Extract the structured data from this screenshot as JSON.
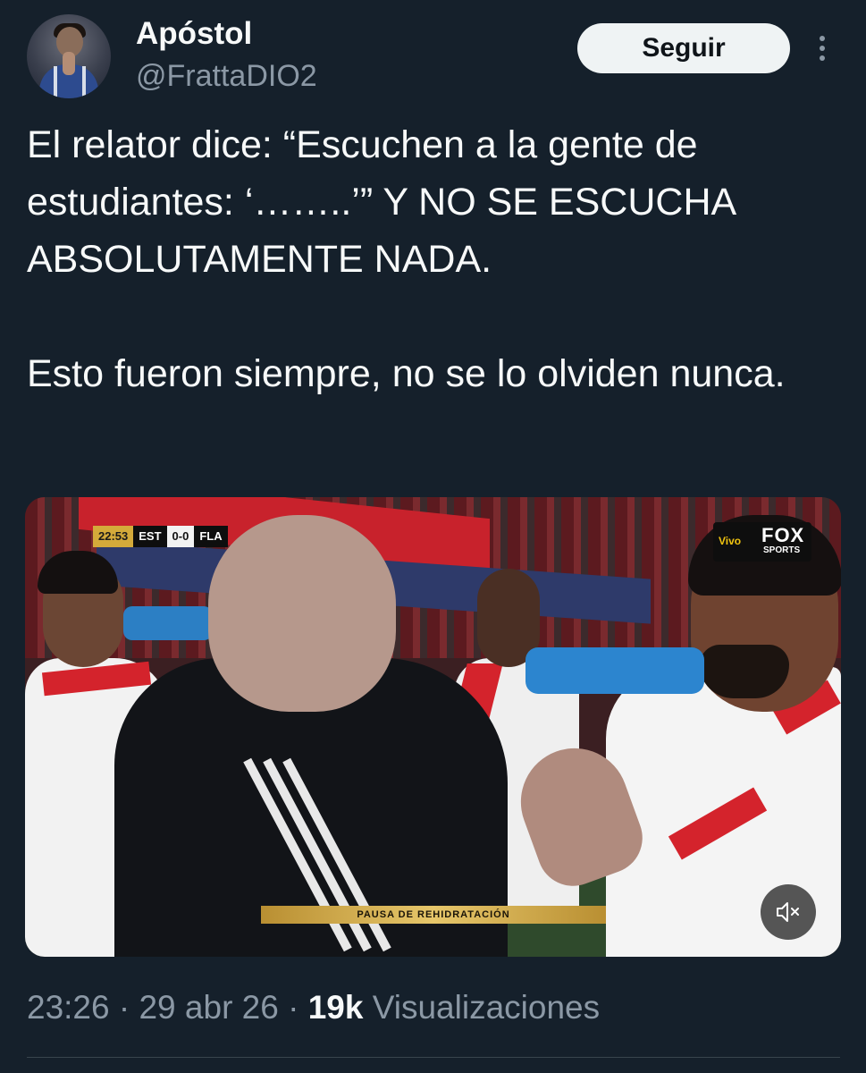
{
  "author": {
    "display_name": "Apóstol",
    "handle": "@FrattaDIO2"
  },
  "actions": {
    "follow_label": "Seguir",
    "more_icon": "more-vertical-icon"
  },
  "tweet": {
    "paragraphs": [
      "El relator dice: “Escuchen a la gente de estudiantes: ‘……..’” Y NO SE ESCUCHA ABSOLUTAMENTE NADA.",
      "Esto fueron siempre, no se lo olviden nunca."
    ]
  },
  "media": {
    "scorebug": {
      "time": "22:53",
      "home": "EST",
      "score": "0-0",
      "away": "FLA"
    },
    "broadcaster": {
      "sponsor": "Vivo",
      "name": "FOX",
      "sub": "SPORTS"
    },
    "caption": "PAUSA DE REHIDRATACIÓN",
    "mute_icon": "volume-mute-icon"
  },
  "meta": {
    "time": "23:26",
    "separator": " · ",
    "date": "29 abr 26",
    "views_count": "19k",
    "views_label": "Visualizaciones"
  },
  "colors": {
    "background": "#15202b",
    "text_primary": "#f7f9f9",
    "text_secondary": "#8b98a5",
    "button_bg": "#eff3f4"
  }
}
